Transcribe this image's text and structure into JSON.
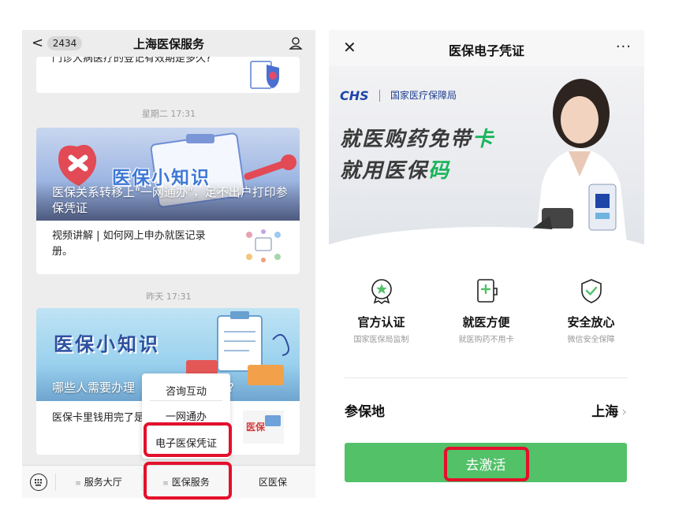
{
  "left_screen": {
    "header": {
      "badge": "2434",
      "title": "上海医保服务"
    },
    "card1": {
      "text": "门诊大病医疗的登记有效期是多久?"
    },
    "time1": "星期二 17:31",
    "card2": {
      "banner_title": "医保小知识",
      "banner_caption": "医保关系转移上\"一网通办\"，足不出户打印参保凭证",
      "sub": "视频讲解 | 如何网上申办就医记录册。"
    },
    "time2": "昨天 17:31",
    "card3": {
      "banner_title": "医保小知识",
      "banner_caption": "哪些人需要办理",
      "banner_caption_end": "?",
      "sub": "医保卡里钱用完了是自费的吗?",
      "thumb_text": "医保"
    },
    "popup_menu": {
      "items": [
        "咨询互动",
        "一网通办",
        "电子医保凭证"
      ]
    },
    "bottom_bar": {
      "tabs": [
        "服务大厅",
        "医保服务",
        "区医保"
      ]
    }
  },
  "right_screen": {
    "header": {
      "title": "医保电子凭证",
      "more": "···"
    },
    "hero": {
      "logo": "CHS",
      "org": "国家医疗保障局",
      "slogan1_a": "就医购药免带",
      "slogan1_b": "卡",
      "slogan2_a": "就用医保",
      "slogan2_b": "码"
    },
    "features": [
      {
        "title": "官方认证",
        "sub": "国家医保局监制",
        "icon": "star-badge-icon"
      },
      {
        "title": "就医方便",
        "sub": "就医购药不用卡",
        "icon": "phone-plus-icon"
      },
      {
        "title": "安全放心",
        "sub": "微信安全保障",
        "icon": "shield-check-icon"
      }
    ],
    "insured_place": {
      "label": "参保地",
      "value": "上海"
    },
    "activate_button": "去激活"
  },
  "colors": {
    "green": "#52c168",
    "highlight_red": "#e4102b",
    "brand_blue": "#1d46a8"
  }
}
